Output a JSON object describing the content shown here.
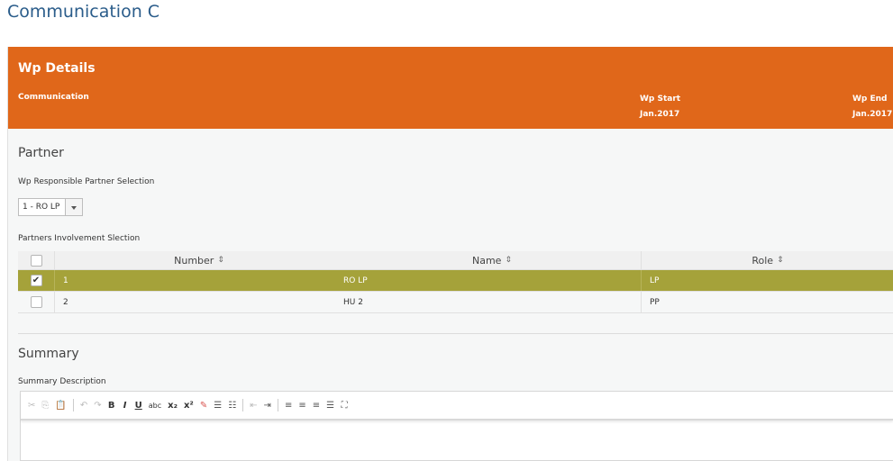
{
  "page_title": "Communication C",
  "header": {
    "title": "Wp Details",
    "subtitle": "Communication",
    "wp_start_label": "Wp Start",
    "wp_start_value": "Jan.2017",
    "wp_end_label": "Wp End",
    "wp_end_value": "Jan.2017",
    "color": "#e0671a"
  },
  "partner": {
    "section_title": "Partner",
    "responsible_label": "Wp Responsible Partner Selection",
    "responsible_value": "1 - RO LP",
    "involvement_label": "Partners Involvement Slection",
    "columns": [
      "Number",
      "Name",
      "Role"
    ],
    "rows": [
      {
        "number": "1",
        "name": "RO LP",
        "role": "LP",
        "checked": true
      },
      {
        "number": "2",
        "name": "HU 2",
        "role": "PP",
        "checked": false
      }
    ],
    "selected_row_color": "#a5a23a"
  },
  "summary": {
    "section_title": "Summary",
    "description_label": "Summary Description",
    "toolbar": [
      "cut-icon",
      "copy-icon",
      "paste-icon",
      "undo-icon",
      "redo-icon",
      "bold",
      "italic",
      "underline",
      "strikethrough",
      "subscript",
      "superscript",
      "remove-format-icon",
      "numbered-list-icon",
      "bulleted-list-icon",
      "outdent-icon",
      "indent-icon",
      "align-left-icon",
      "align-center-icon",
      "align-right-icon",
      "justify-icon",
      "maximize-icon"
    ]
  }
}
